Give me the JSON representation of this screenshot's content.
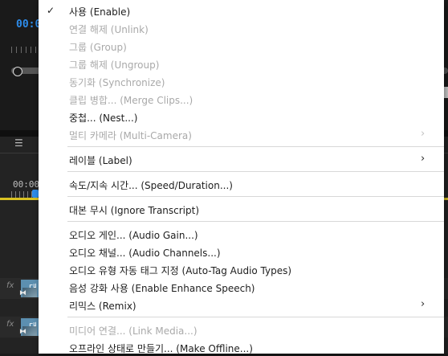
{
  "background": {
    "monitor_timecode": "00:0",
    "timeline_time": "00:00",
    "clip_label_1": "대",
    "clip_label_2": "대"
  },
  "menu": {
    "items": [
      {
        "label": "사용 (Enable)",
        "checked": true,
        "enabled": true
      },
      {
        "label": "연결 해제 (Unlink)",
        "enabled": false
      },
      {
        "label": "그룹 (Group)",
        "enabled": false
      },
      {
        "label": "그룹 해제 (Ungroup)",
        "enabled": false
      },
      {
        "label": "동기화 (Synchronize)",
        "enabled": false
      },
      {
        "label": "클립 병합... (Merge Clips...)",
        "enabled": false
      },
      {
        "label": "중첩... (Nest...)",
        "enabled": true
      },
      {
        "label": "멀티 카메라 (Multi-Camera)",
        "enabled": false,
        "submenu": true
      },
      {
        "label": "레이블 (Label)",
        "enabled": true,
        "submenu": true
      },
      {
        "label": "속도/지속 시간... (Speed/Duration...)",
        "enabled": true
      },
      {
        "label": "대본 무시 (Ignore Transcript)",
        "enabled": true
      },
      {
        "label": "오디오 게인... (Audio Gain...)",
        "enabled": true
      },
      {
        "label": "오디오 채널... (Audio Channels...)",
        "enabled": true
      },
      {
        "label": "오디오 유형 자동 태그 지정 (Auto-Tag Audio Types)",
        "enabled": true
      },
      {
        "label": "음성 강화 사용 (Enable Enhance Speech)",
        "enabled": true
      },
      {
        "label": "리믹스 (Remix)",
        "enabled": true,
        "submenu": true
      },
      {
        "label": "미디어 연결... (Link Media...)",
        "enabled": false
      },
      {
        "label": "오프라인 상태로 만들기... (Make Offline...)",
        "enabled": true
      }
    ],
    "check_glyph": "✓",
    "submenu_glyph": "›"
  },
  "colors": {
    "menu_bg": "#ffffff",
    "text_enabled": "#1e1e1e",
    "text_disabled": "#a9a9a9",
    "separator": "#d8d8d8",
    "accent_blue": "#2d8ceb",
    "work_area_yellow": "#d9c222"
  }
}
